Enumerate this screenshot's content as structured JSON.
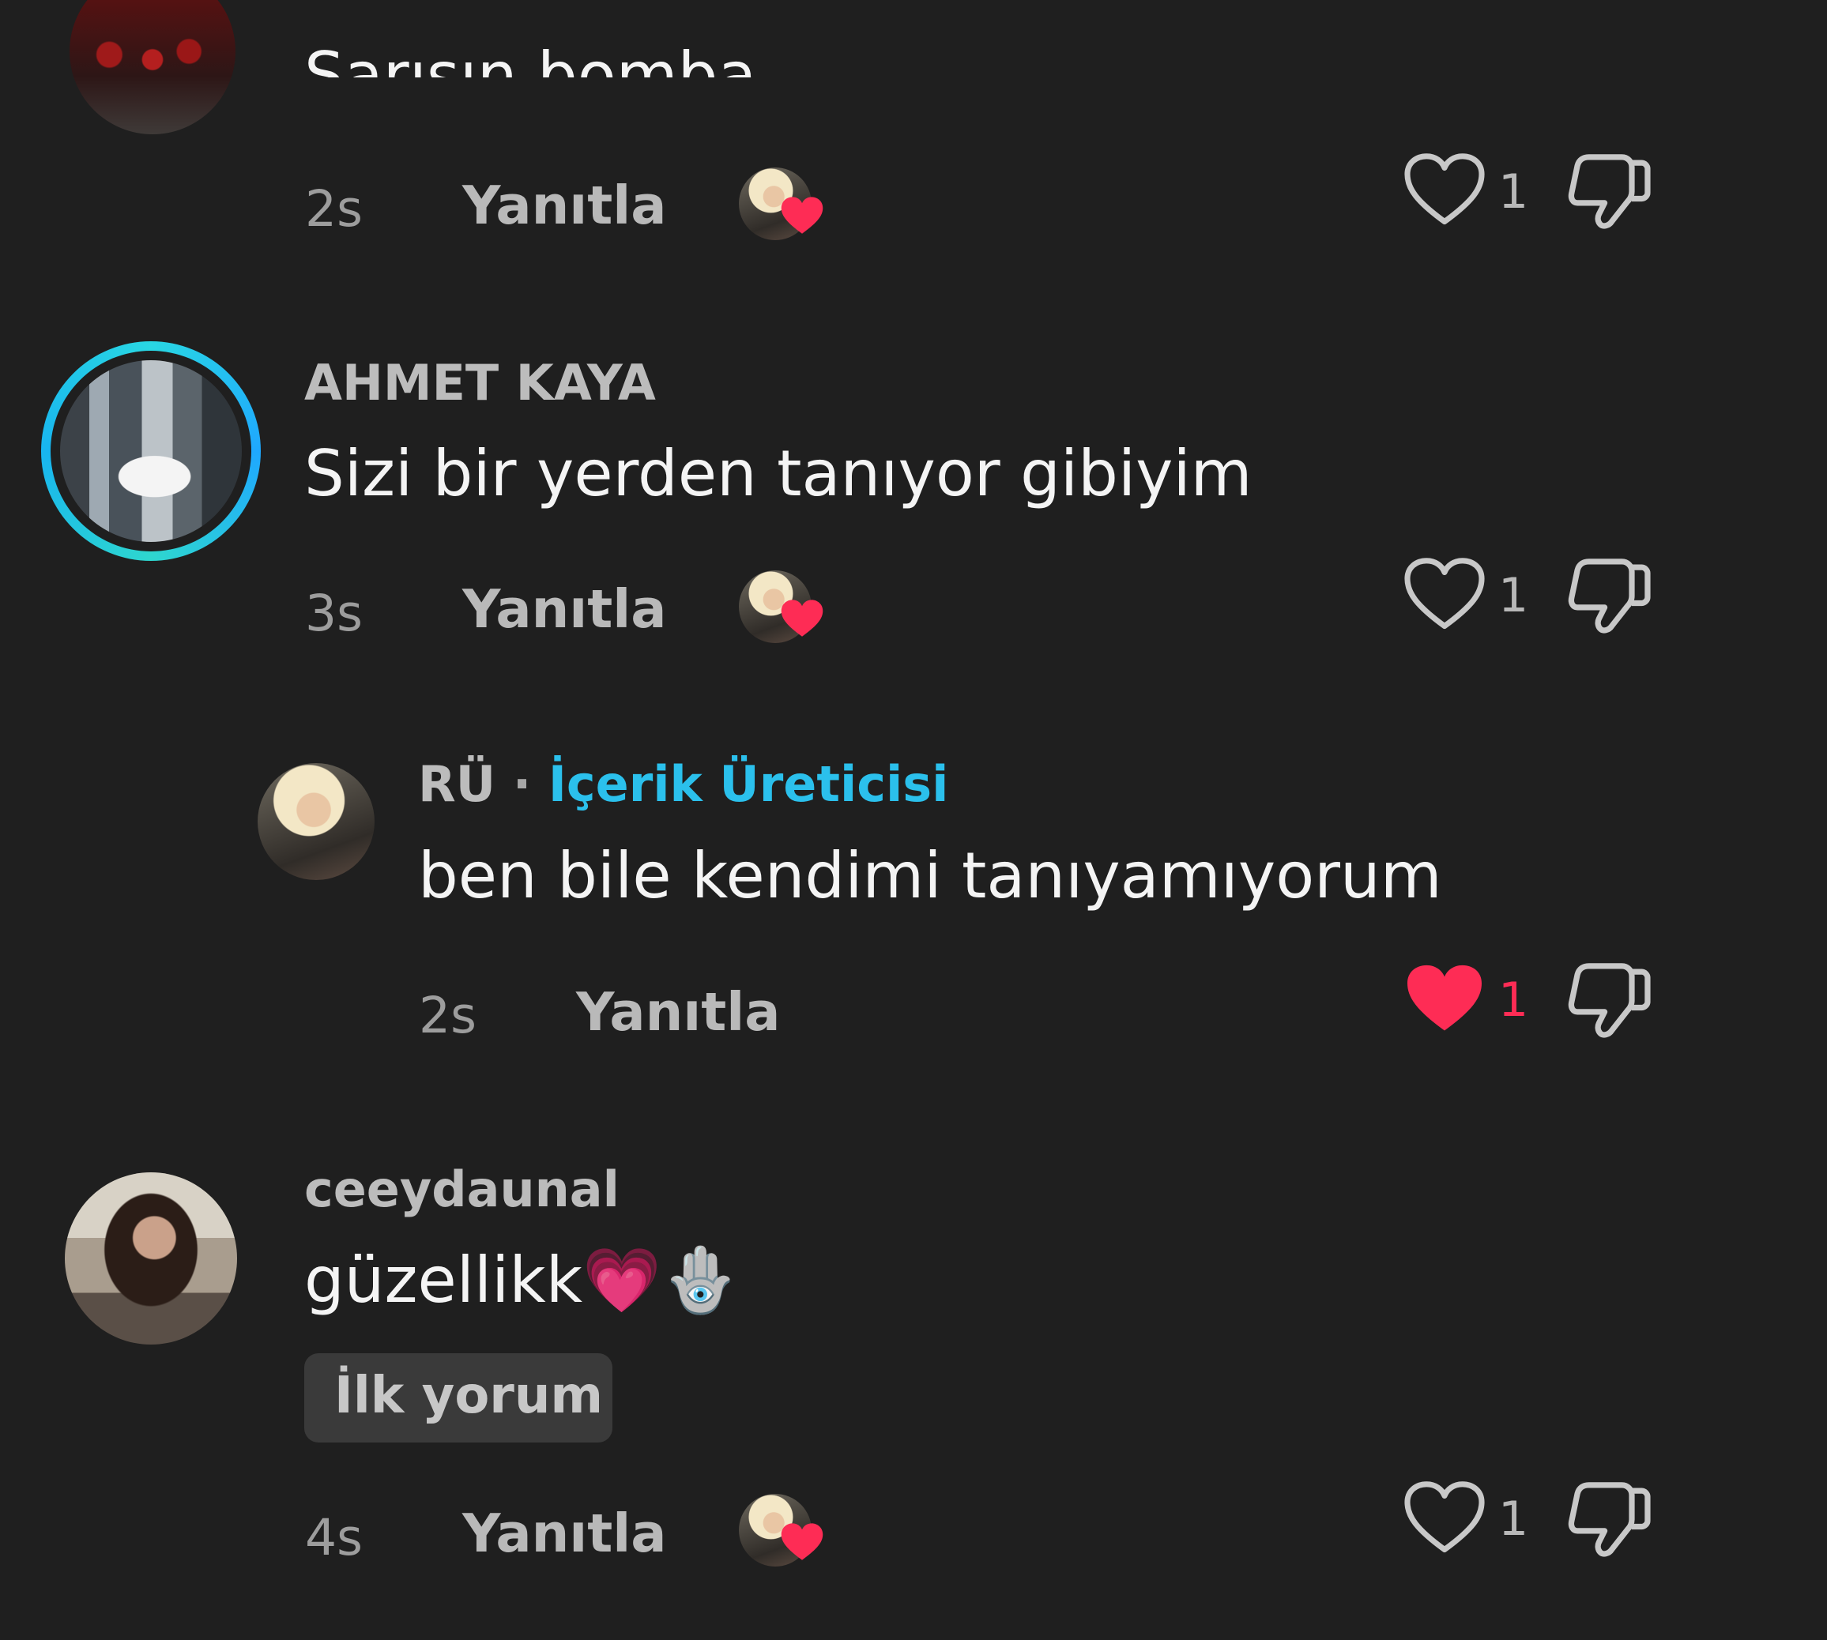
{
  "comments": [
    {
      "text": "Sarışın bomba",
      "time": "2s",
      "reply_label": "Yanıtla",
      "likes": "1"
    },
    {
      "username": "AHMET KAYA",
      "text": "Sizi bir yerden tanıyor gibiyim",
      "time": "3s",
      "reply_label": "Yanıtla",
      "likes": "1"
    },
    {
      "username": "RÜ",
      "separator": "·",
      "creator_label": "İçerik Üreticisi",
      "text": "ben bile kendimi tanıyamıyorum",
      "time": "2s",
      "reply_label": "Yanıtla",
      "likes": "1"
    },
    {
      "username": "ceeydaunal",
      "text": "güzellikk💗🪬",
      "tag": "İlk yorum",
      "time": "4s",
      "reply_label": "Yanıtla",
      "likes": "1"
    }
  ],
  "icons": {
    "like_outline": "heart-outline-icon",
    "like_filled": "heart-filled-icon",
    "dislike": "thumbs-down-icon",
    "creator_liked": "creator-liked-heart-icon"
  },
  "colors": {
    "background": "#1f1f1f",
    "accent_red": "#fe2c55",
    "creator_blue": "#2bc0ec",
    "story_ring": "#29d7e3"
  }
}
